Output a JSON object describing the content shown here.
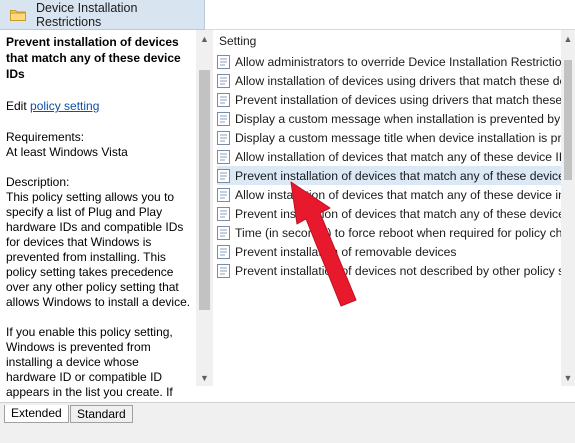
{
  "header": {
    "title": "Device Installation Restrictions"
  },
  "description": {
    "title": "Prevent installation of devices that match any of these device IDs",
    "edit_prefix": "Edit ",
    "edit_link": "policy setting",
    "requirements": "Requirements:\nAt least Windows Vista",
    "description": "Description:\nThis policy setting allows you to specify a list of Plug and Play hardware IDs and compatible IDs for devices that Windows is prevented from installing. This policy setting takes precedence over any other policy setting that allows Windows to install a device.",
    "enable_text": "If you enable this policy setting, Windows is prevented from installing a device whose hardware ID or compatible ID appears in the list you create. If you enable this policy setting on a remote desktop server, the policy"
  },
  "list": {
    "column_header": "Setting",
    "items": [
      "Allow administrators to override Device Installation Restriction ...",
      "Allow installation of devices using drivers that match these devi...",
      "Prevent installation of devices using drivers that match these de...",
      "Display a custom message when installation is prevented by a p...",
      "Display a custom message title when device installation is preve...",
      "Allow installation of devices that match any of these device IDs",
      "Prevent installation of devices that match any of these device IDs",
      "Allow installation of devices that match any of these device inst...",
      "Prevent installation of devices that match any of these device in...",
      "Time (in seconds) to force reboot when required for policy chan...",
      "Prevent installation of removable devices",
      "Prevent installation of devices not described by other policy sett..."
    ],
    "selected_index": 6
  },
  "tabs": {
    "extended": "Extended",
    "standard": "Standard"
  },
  "colors": {
    "arrow": "#e8192c",
    "selected_row": "#dbe8f6",
    "header_tab": "#d9e4f1",
    "link": "#0d4fa8"
  },
  "icons": {
    "folder": "folder-icon",
    "policy": "policy-setting-icon",
    "pointer": "red-arrow-annotation"
  }
}
